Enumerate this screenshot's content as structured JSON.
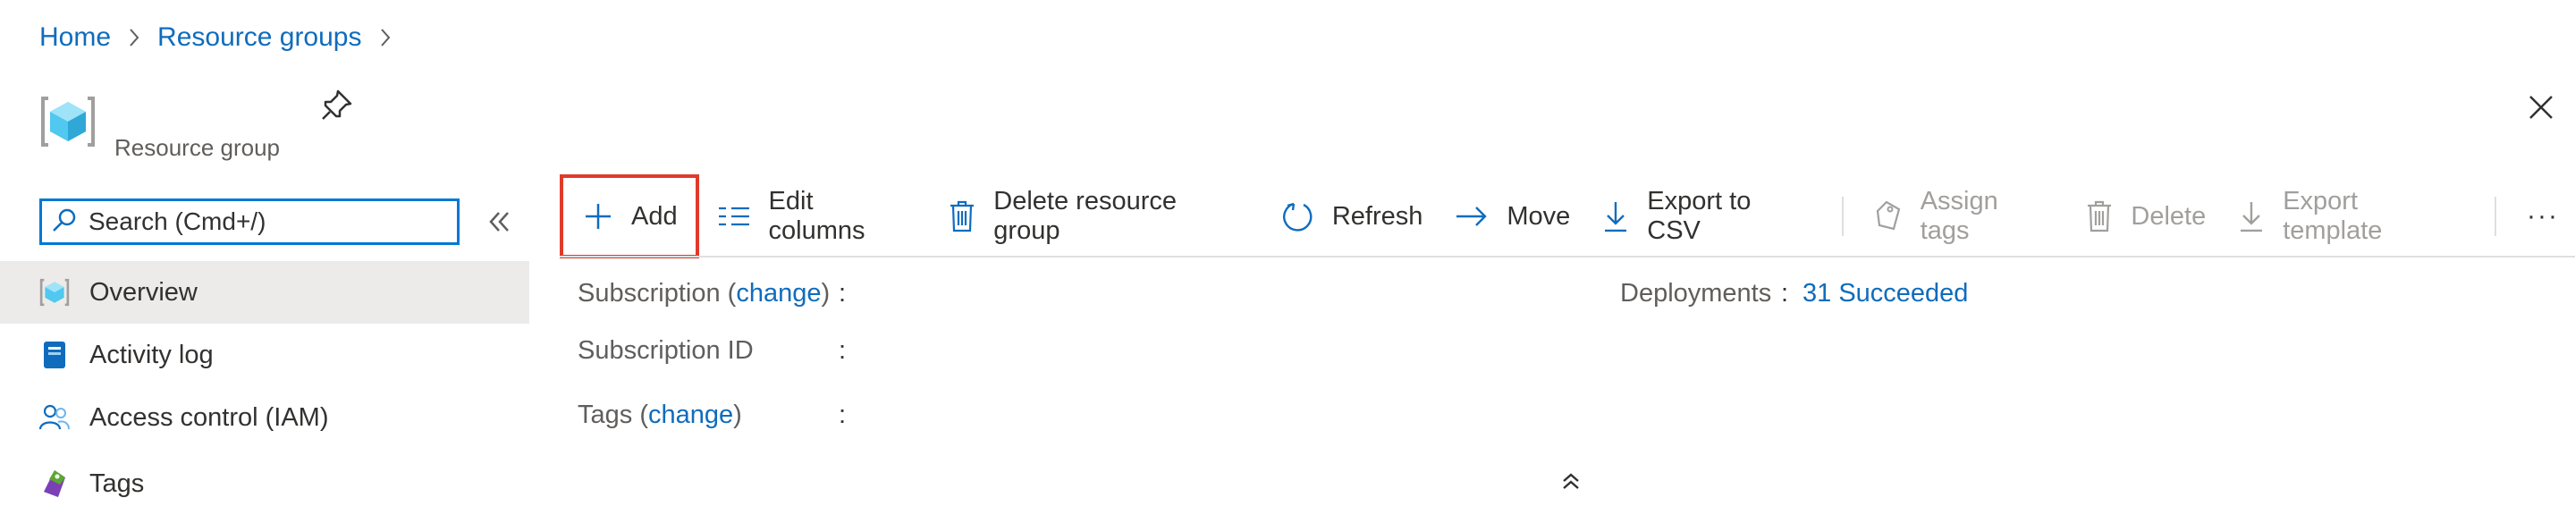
{
  "breadcrumb": {
    "items": [
      "Home",
      "Resource groups"
    ]
  },
  "header": {
    "title": "",
    "subtitle": "Resource group"
  },
  "search": {
    "placeholder": "Search (Cmd+/)"
  },
  "sidebar": {
    "items": [
      {
        "label": "Overview",
        "active": true
      },
      {
        "label": "Activity log"
      },
      {
        "label": "Access control (IAM)"
      },
      {
        "label": "Tags"
      }
    ]
  },
  "toolbar": {
    "add": "Add",
    "edit_columns": "Edit columns",
    "delete_group": "Delete resource group",
    "refresh": "Refresh",
    "move": "Move",
    "export_csv": "Export to CSV",
    "assign_tags": "Assign tags",
    "delete": "Delete",
    "export_template": "Export template",
    "more": "···"
  },
  "essentials": {
    "subscription_label": "Subscription (",
    "subscription_change": "change",
    "subscription_close": ")",
    "subscription_id_label": "Subscription ID",
    "tags_label": "Tags (",
    "tags_change": "change",
    "tags_close": ")",
    "colon": ":",
    "deployments_label": "Deployments",
    "deployments_value": "31 Succeeded"
  },
  "colors": {
    "accent": "#0f6cbd",
    "highlight": "#e03a2b",
    "active_bg": "#edebe9"
  }
}
